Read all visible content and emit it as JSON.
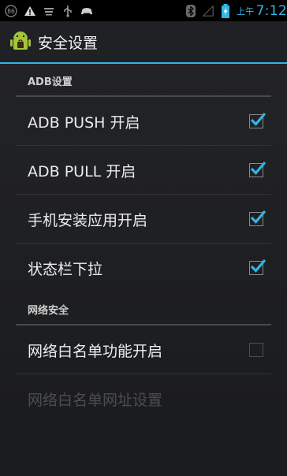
{
  "status_bar": {
    "time_ampm": "上午",
    "time": "7:12",
    "notification_badge": "86",
    "icons": [
      "badge-icon",
      "warning-icon",
      "usb-icon",
      "usb-icon",
      "game-icon",
      "bluetooth-icon",
      "signal-icon",
      "battery-charging-icon"
    ],
    "accent_color": "#33b5e5"
  },
  "action_bar": {
    "title": "安全设置",
    "icon": "android-icon"
  },
  "sections": [
    {
      "header": "ADB设置",
      "items": [
        {
          "label": "ADB PUSH 开启",
          "checked": true
        },
        {
          "label": "ADB PULL 开启",
          "checked": true
        },
        {
          "label": "手机安装应用开启",
          "checked": true
        },
        {
          "label": "状态栏下拉",
          "checked": true
        }
      ]
    },
    {
      "header": "网络安全",
      "items": [
        {
          "label": "网络白名单功能开启",
          "checked": false
        },
        {
          "label": "网络白名单网址设置",
          "disabled": true
        }
      ]
    }
  ]
}
